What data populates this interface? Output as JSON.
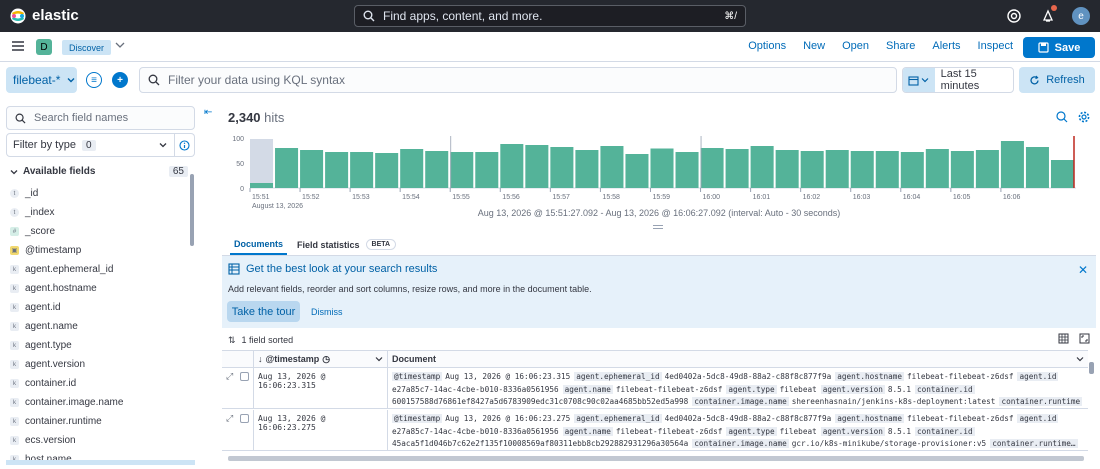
{
  "topbar": {
    "brand": "elastic",
    "search_placeholder": "Find apps, content, and more.",
    "search_shortcut": "⌘/",
    "avatar_letter": "e"
  },
  "nav": {
    "app_letter": "D",
    "breadcrumb": "Discover",
    "links": [
      "Options",
      "New",
      "Open",
      "Share",
      "Alerts",
      "Inspect"
    ],
    "save_label": "Save"
  },
  "query": {
    "data_view": "filebeat-*",
    "kql_placeholder": "Filter your data using KQL syntax",
    "time_range": "Last 15 minutes",
    "refresh_label": "Refresh"
  },
  "sidebar": {
    "search_placeholder": "Search field names",
    "filter_label": "Filter by type",
    "filter_count": "0",
    "available_label": "Available fields",
    "available_count": "65",
    "fields": [
      {
        "name": "_id",
        "type": "t"
      },
      {
        "name": "_index",
        "type": "t"
      },
      {
        "name": "_score",
        "type": "#"
      },
      {
        "name": "@timestamp",
        "type": "d"
      },
      {
        "name": "agent.ephemeral_id",
        "type": "k"
      },
      {
        "name": "agent.hostname",
        "type": "k"
      },
      {
        "name": "agent.id",
        "type": "k"
      },
      {
        "name": "agent.name",
        "type": "k"
      },
      {
        "name": "agent.type",
        "type": "k"
      },
      {
        "name": "agent.version",
        "type": "k"
      },
      {
        "name": "container.id",
        "type": "k"
      },
      {
        "name": "container.image.name",
        "type": "k"
      },
      {
        "name": "container.runtime",
        "type": "k"
      },
      {
        "name": "ecs.version",
        "type": "k"
      },
      {
        "name": "host.name",
        "type": "k"
      }
    ]
  },
  "main": {
    "hits_count": "2,340",
    "hits_label": "hits",
    "interval_text": "Aug 13, 2026 @ 15:51:27.092 - Aug 13, 2026 @ 16:06:27.092 (interval: Auto - 30 seconds)",
    "tabs": [
      "Documents",
      "Field statistics"
    ],
    "beta_label": "BETA",
    "callout_title": "Get the best look at your search results",
    "callout_desc": "Add relevant fields, reorder and sort columns, resize rows, and more in the document table.",
    "tour_label": "Take the tour",
    "dismiss_label": "Dismiss",
    "sorted_label": "1 field sorted",
    "col_timestamp": "@timestamp",
    "col_document": "Document",
    "rows": [
      {
        "timestamp": "Aug 13, 2026 @ 16:06:23.315",
        "line1": [
          [
            "@timestamp",
            "Aug 13, 2026 @ 16:06:23.315"
          ],
          [
            "agent.ephemeral_id",
            "4ed0402a-5dc8-49d8-88a2-c88f8c877f9a"
          ],
          [
            "agent.hostname",
            "filebeat-filebeat-z6dsf"
          ],
          [
            "agent.id",
            ""
          ]
        ],
        "line2": [
          [
            "",
            "e27a85c7-14ac-4cbe-b010-8336a0561956"
          ],
          [
            "agent.name",
            "filebeat-filebeat-z6dsf"
          ],
          [
            "agent.type",
            "filebeat"
          ],
          [
            "agent.version",
            "8.5.1"
          ],
          [
            "container.id",
            ""
          ]
        ],
        "line3": [
          [
            "",
            "600157588d76861ef8427a5d6783909edc31c0708c90c02aa4685bb52ed5a998"
          ],
          [
            "container.image.name",
            "shereenhasnain/jenkins-k8s-deployment:latest"
          ],
          [
            "container.runtime",
            ""
          ]
        ]
      },
      {
        "timestamp": "Aug 13, 2026 @ 16:06:23.275",
        "line1": [
          [
            "@timestamp",
            "Aug 13, 2026 @ 16:06:23.275"
          ],
          [
            "agent.ephemeral_id",
            "4ed0402a-5dc8-49d8-88a2-c88f8c877f9a"
          ],
          [
            "agent.hostname",
            "filebeat-filebeat-z6dsf"
          ],
          [
            "agent.id",
            ""
          ]
        ],
        "line2": [
          [
            "",
            "e27a85c7-14ac-4cbe-b010-8336a0561956"
          ],
          [
            "agent.name",
            "filebeat-filebeat-z6dsf"
          ],
          [
            "agent.type",
            "filebeat"
          ],
          [
            "agent.version",
            "8.5.1"
          ],
          [
            "container.id",
            ""
          ]
        ],
        "line3": [
          [
            "",
            "45aca5f1d046b7c62e2f135f10008569af80311ebb8cb292882931296a30564a"
          ],
          [
            "container.image.name",
            "gcr.io/k8s-minikube/storage-provisioner:v5"
          ],
          [
            "container.runtime…",
            ""
          ]
        ]
      }
    ]
  },
  "colors": {
    "bar": "#54b399",
    "bar_partial": "#d3dae6",
    "accent": "#0077cc",
    "now_line": "#bd271e"
  },
  "chart_data": {
    "type": "bar",
    "y_ticks": [
      "100",
      "50",
      "0"
    ],
    "ylim": [
      0,
      100
    ],
    "x_ticks": [
      "15:51",
      "15:52",
      "15:53",
      "15:54",
      "15:55",
      "15:56",
      "15:57",
      "15:58",
      "15:59",
      "16:00",
      "16:01",
      "16:02",
      "16:03",
      "16:04",
      "16:05",
      "16:06"
    ],
    "x_date_label": "August 13, 2026",
    "values": [
      80,
      76,
      72,
      72,
      70,
      78,
      74,
      72,
      72,
      88,
      86,
      82,
      76,
      84,
      68,
      79,
      72,
      80,
      78,
      84,
      76,
      74,
      76,
      74,
      74,
      72,
      78,
      74,
      76,
      94,
      82,
      56
    ],
    "partial_first": 98
  }
}
